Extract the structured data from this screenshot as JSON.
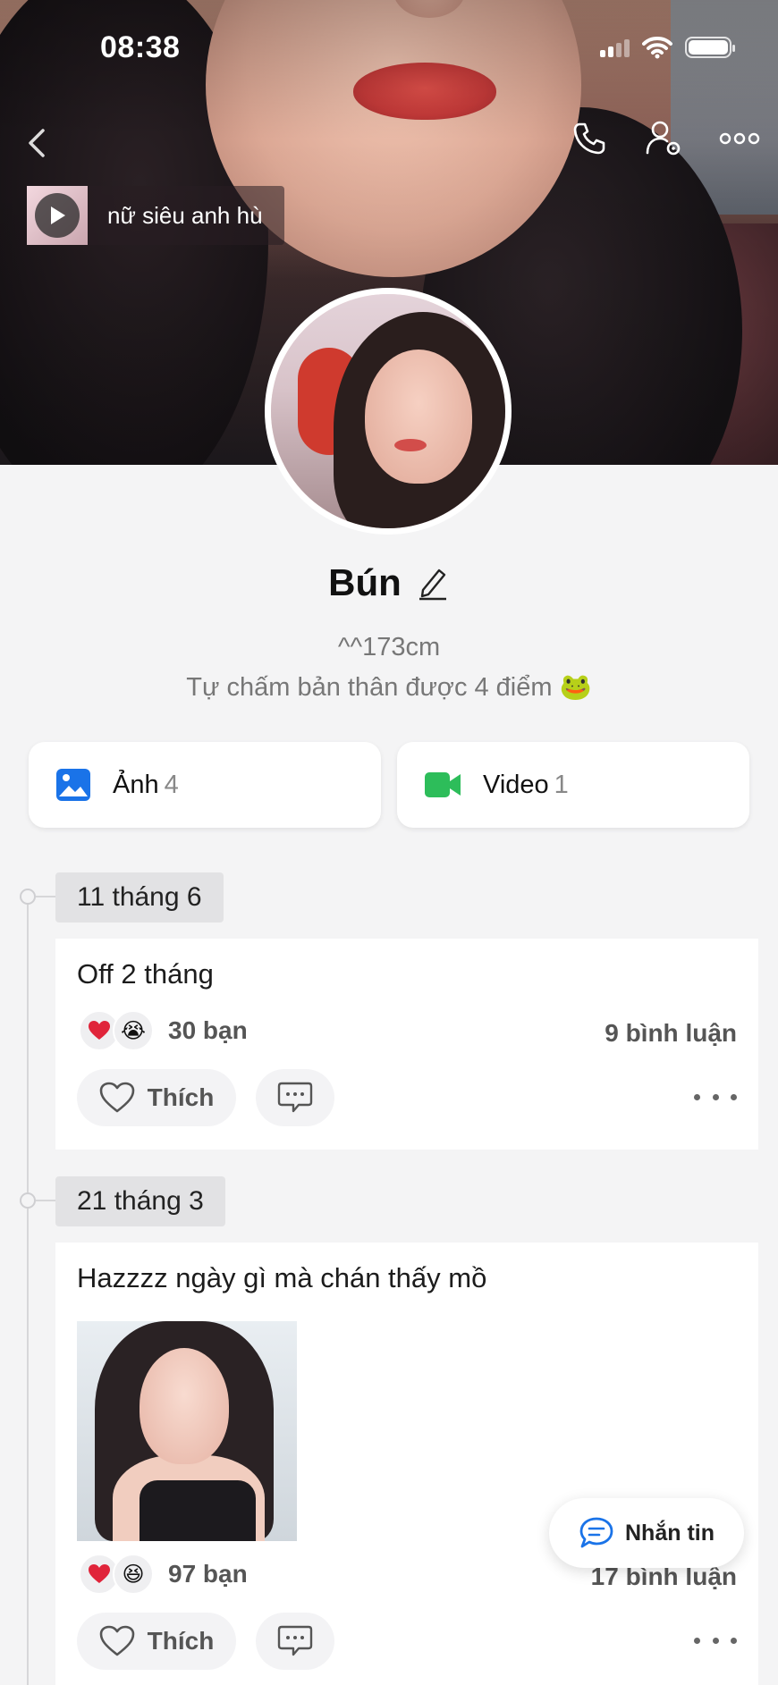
{
  "status_bar": {
    "time": "08:38"
  },
  "music": {
    "title": "nữ siêu anh hù"
  },
  "profile": {
    "name": "Bún",
    "bio_line1": "^^173cm",
    "bio_line2": "Tự chấm bản thân được 4 điểm 🐸"
  },
  "media": {
    "photos_label": "Ảnh",
    "photos_count": "4",
    "videos_label": "Video",
    "videos_count": "1"
  },
  "posts": [
    {
      "date": "11 tháng 6",
      "text": "Off 2 tháng",
      "reaction_icons": [
        "heart-icon",
        "crying-face-icon"
      ],
      "reactions": "30 bạn",
      "comments": "9 bình luận",
      "like_label": "Thích"
    },
    {
      "date": "21 tháng 3",
      "text": "Hazzzz ngày gì mà chán thấy mồ",
      "reaction_icons": [
        "heart-icon",
        "laughing-face-icon"
      ],
      "reactions": "97 bạn",
      "comments": "17 bình luận",
      "like_label": "Thích"
    }
  ],
  "message_button": {
    "label": "Nhắn tin"
  },
  "colors": {
    "accent_blue": "#1a73e8",
    "video_green": "#2dbd5a",
    "heart_red": "#e0243a"
  }
}
